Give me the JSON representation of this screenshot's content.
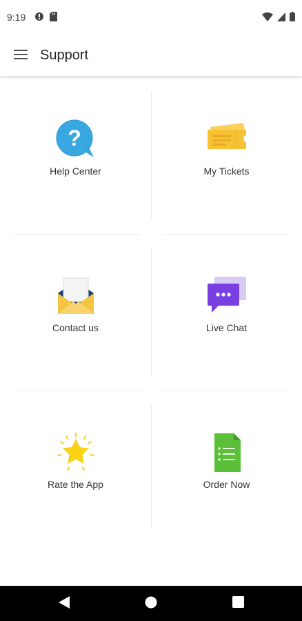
{
  "status_bar": {
    "time": "9:19",
    "icons_left": [
      "alert-circle-icon",
      "sd-card-icon"
    ],
    "icons_right": [
      "wifi-icon",
      "signal-icon",
      "battery-icon"
    ]
  },
  "app_bar": {
    "title": "Support",
    "menu_icon": "hamburger-menu-icon"
  },
  "tiles": [
    {
      "label": "Help Center",
      "icon": "help-bubble-icon"
    },
    {
      "label": "My Tickets",
      "icon": "ticket-icon"
    },
    {
      "label": "Contact us",
      "icon": "envelope-icon"
    },
    {
      "label": "Live Chat",
      "icon": "chat-bubble-icon"
    },
    {
      "label": "Rate the App",
      "icon": "star-icon"
    },
    {
      "label": "Order Now",
      "icon": "document-list-icon"
    }
  ],
  "nav_bar": {
    "back_icon": "back-triangle-icon",
    "home_icon": "home-circle-icon",
    "recents_icon": "recents-square-icon"
  },
  "colors": {
    "help_blue": "#3aa8e0",
    "ticket_yellow": "#f7c335",
    "envelope_yellow": "#f5c542",
    "chat_purple": "#7a3fe0",
    "star_yellow": "#fcd215",
    "doc_green": "#5cbf3a"
  }
}
